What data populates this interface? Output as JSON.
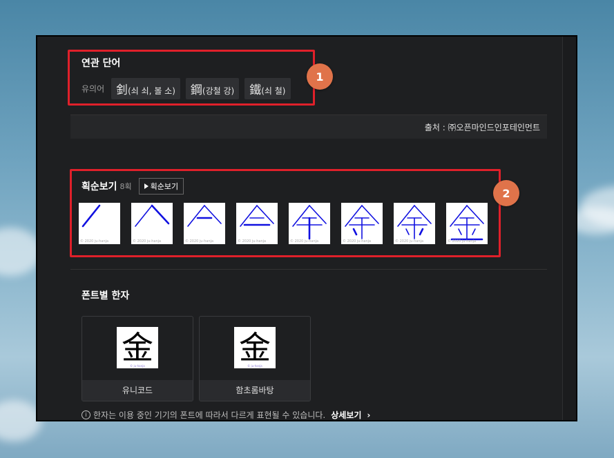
{
  "related": {
    "title": "연관 단어",
    "synonym_label": "유의어",
    "chips": [
      {
        "han": "釗",
        "reading": "(쇠 쇠, 볼 소)"
      },
      {
        "han": "鋼",
        "reading": "(강철 강)"
      },
      {
        "han": "鐵",
        "reading": "(쇠 철)"
      }
    ]
  },
  "source": "출처 : ㈜오픈마인드인포테인먼트",
  "stroke_order": {
    "title": "획순보기",
    "count": "8획",
    "button_label": "획순보기",
    "steps": 8,
    "watermark": "© 2020 ju-hanja",
    "stroke_color": "#1010e0"
  },
  "fonts": {
    "title": "폰트별 한자",
    "cards": [
      {
        "char": "金",
        "caption": "유니코드",
        "mini": "© ju-hanja"
      },
      {
        "char": "金",
        "caption": "함초롬바탕",
        "mini": "© ju-hanja"
      }
    ]
  },
  "notice": {
    "icon": "i",
    "text": "한자는 이용 중인 기기의 폰트에 따라서 다르게 표현될 수 있습니다.",
    "more": "상세보기"
  },
  "annotations": [
    "1",
    "2"
  ],
  "colors": {
    "highlight": "#e0202a",
    "badge": "#e0734a"
  }
}
